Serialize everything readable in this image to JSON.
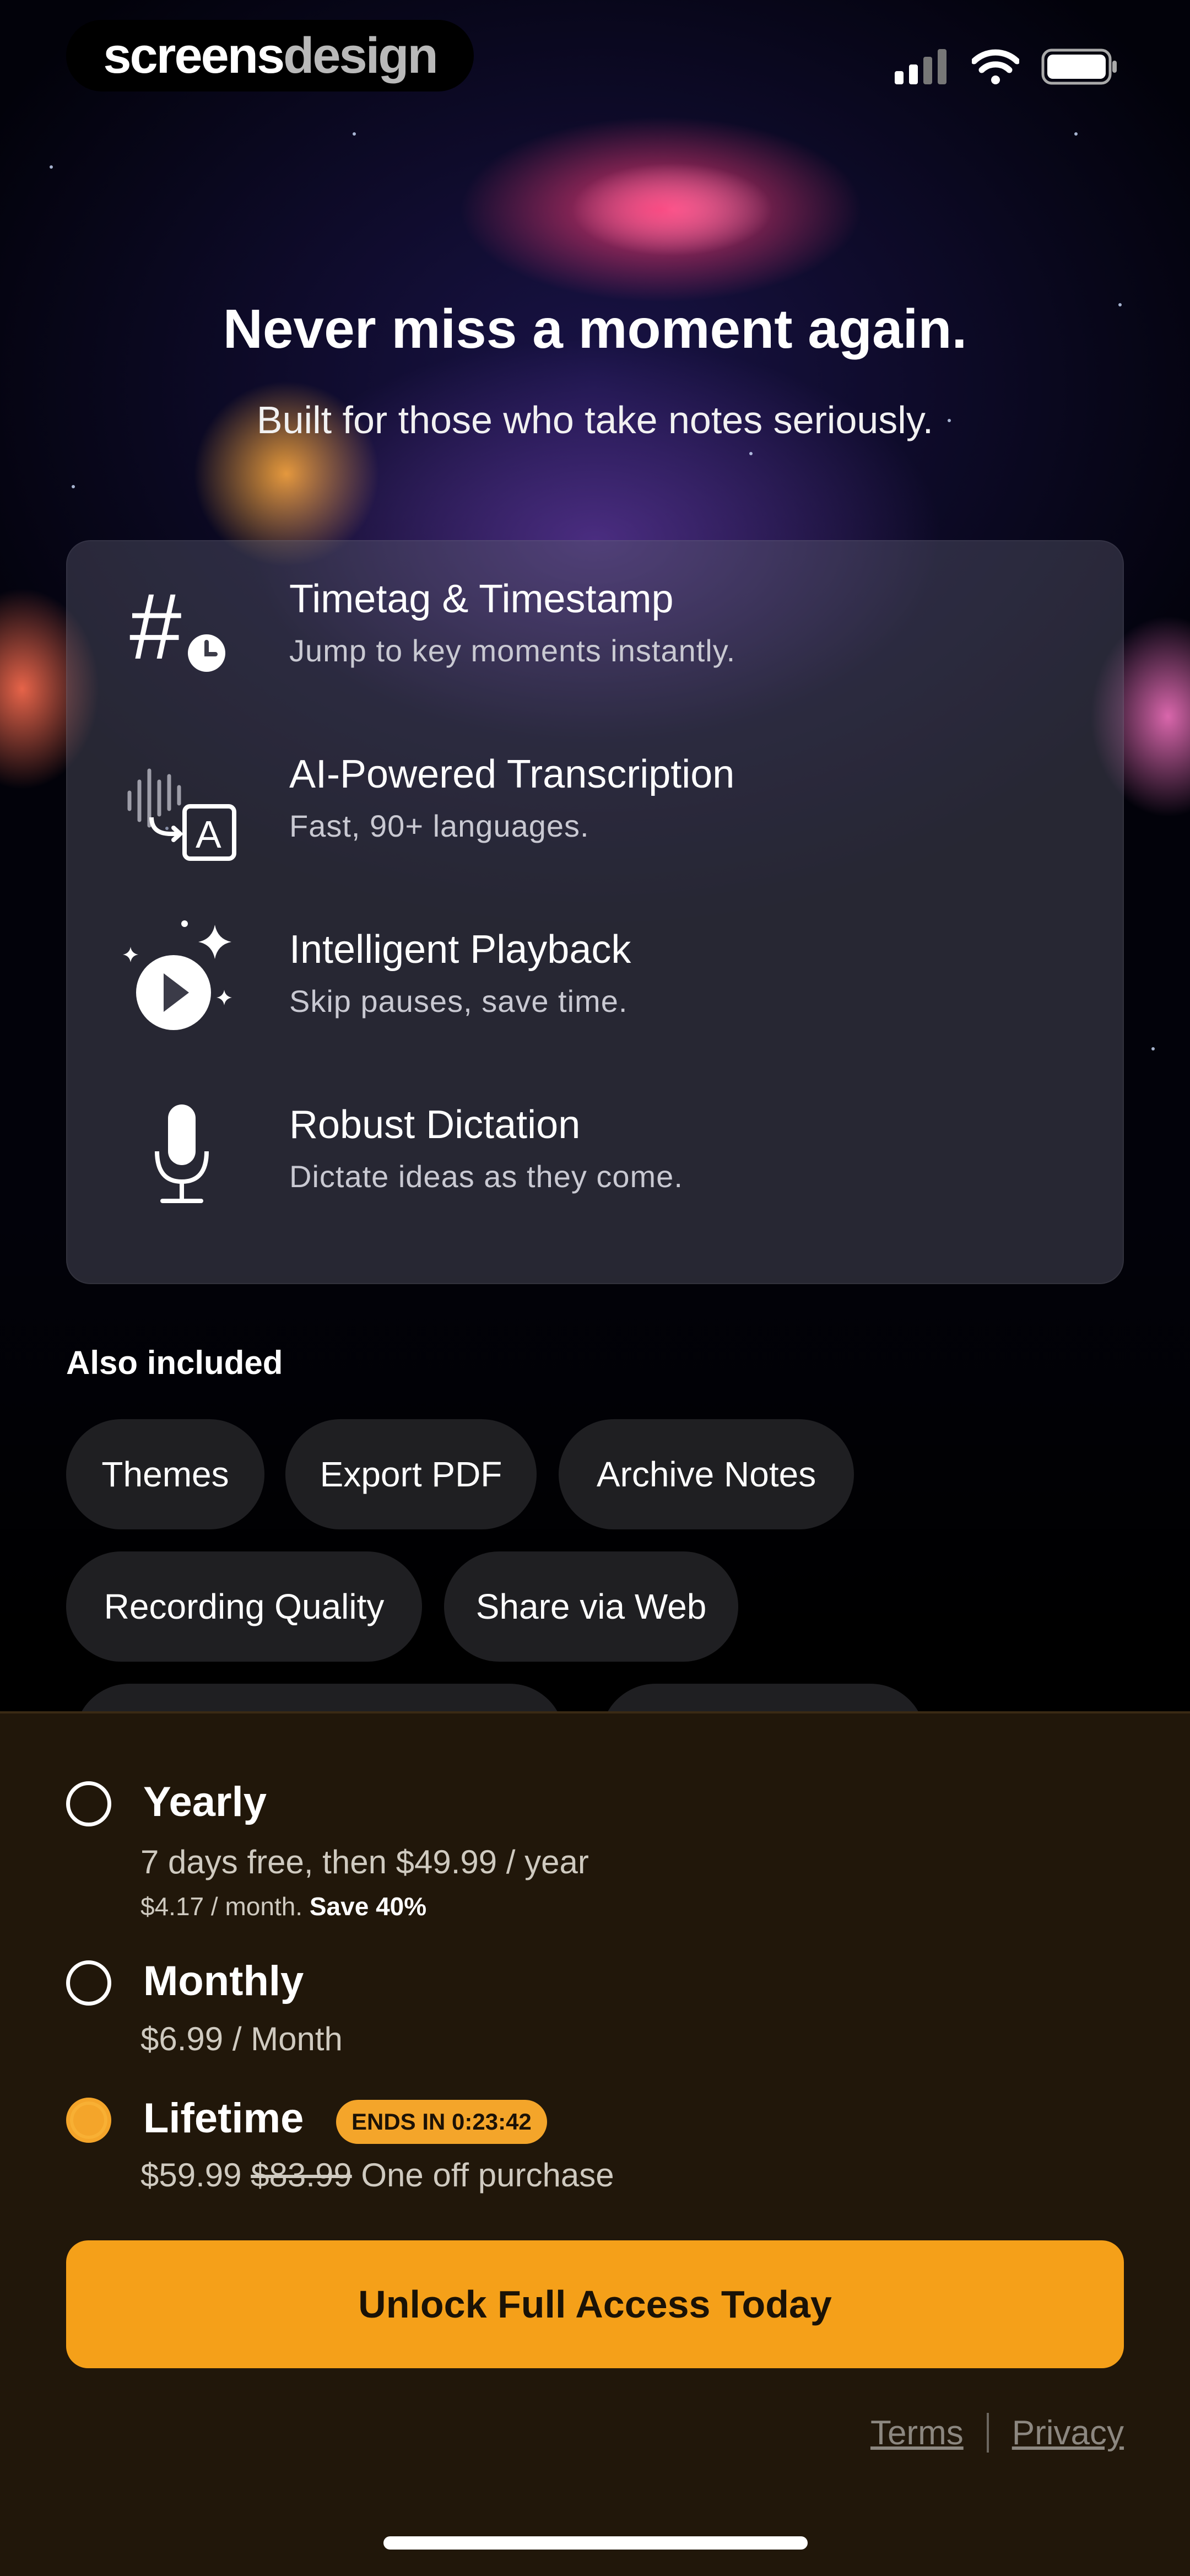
{
  "brand": {
    "part1": "screens",
    "part2": "design"
  },
  "status_bar": {
    "signal_icon": "signal-bars-icon",
    "wifi_icon": "wifi-icon",
    "battery_icon": "battery-icon"
  },
  "hero": {
    "title": "Never miss a moment again.",
    "subtitle": "Built for those who take notes seriously."
  },
  "features": [
    {
      "icon": "timestamp-hashtag-icon",
      "title": "Timetag & Timestamp",
      "desc": "Jump to key moments instantly."
    },
    {
      "icon": "transcription-icon",
      "title": "AI-Powered Transcription",
      "desc": "Fast, 90+ languages."
    },
    {
      "icon": "smart-playback-icon",
      "title": "Intelligent Playback",
      "desc": "Skip pauses, save time."
    },
    {
      "icon": "microphone-icon",
      "title": "Robust Dictation",
      "desc": "Dictate ideas as they come."
    }
  ],
  "also_included": {
    "title": "Also included",
    "chips": [
      "Themes",
      "Export PDF",
      "Archive Notes",
      "Recording Quality",
      "Share via Web"
    ]
  },
  "plans": {
    "yearly": {
      "name": "Yearly",
      "line1": "7 days free, then $49.99 / year",
      "line2": "$4.17 / month.",
      "save": "Save 40%",
      "selected": false
    },
    "monthly": {
      "name": "Monthly",
      "line1": "$6.99 / Month",
      "selected": false
    },
    "lifetime": {
      "name": "Lifetime",
      "badge": "ENDS IN 0:23:42",
      "price": "$59.99",
      "old_price": "$83.99",
      "note": "One off purchase",
      "selected": true
    }
  },
  "cta": {
    "label": "Unlock Full Access Today"
  },
  "footer": {
    "terms": "Terms",
    "privacy": "Privacy"
  },
  "colors": {
    "accent": "#f5a019",
    "sheet_bg": "#21170a",
    "card_bg": "#3b3b48"
  }
}
